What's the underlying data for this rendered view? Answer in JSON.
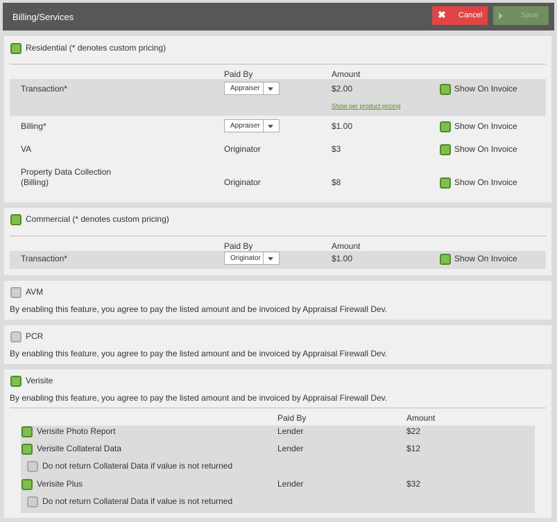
{
  "header": {
    "title": "Billing/Services",
    "cancel_label": "Cancel",
    "save_label": "Save"
  },
  "residential": {
    "title": "Residential (* denotes custom pricing)",
    "headers": {
      "paid_by": "Paid By",
      "amount": "Amount"
    },
    "rows": [
      {
        "name": "Transaction*",
        "paid_by": "Appraiser",
        "amount": "$2.00",
        "invoice": "Show On Invoice",
        "link": "Show per product pricing"
      },
      {
        "name": "Billing*",
        "paid_by": "Appraiser",
        "amount": "$1.00",
        "invoice": "Show On Invoice"
      },
      {
        "name": "VA",
        "paid_by": "Originator",
        "amount": "$3",
        "invoice": "Show On Invoice"
      },
      {
        "name_line1": "Property Data Collection",
        "name_line2": "(Billing)",
        "paid_by": "Originator",
        "amount": "$8",
        "invoice": "Show On Invoice"
      }
    ]
  },
  "commercial": {
    "title": "Commercial (* denotes custom pricing)",
    "headers": {
      "paid_by": "Paid By",
      "amount": "Amount"
    },
    "rows": [
      {
        "name": "Transaction*",
        "paid_by": "Originator",
        "amount": "$1.00",
        "invoice": "Show On Invoice"
      }
    ]
  },
  "avm": {
    "title": "AVM",
    "notice": "By enabling this feature, you agree to pay the listed amount and be invoiced by Appraisal Firewall Dev."
  },
  "pcr": {
    "title": "PCR",
    "notice": "By enabling this feature, you agree to pay the listed amount and be invoiced by Appraisal Firewall Dev."
  },
  "verisite": {
    "title": "Verisite",
    "notice": "By enabling this feature, you agree to pay the listed amount and be invoiced by Appraisal Firewall Dev.",
    "headers": {
      "paid_by": "Paid By",
      "amount": "Amount"
    },
    "rows": [
      {
        "name": "Verisite Photo Report",
        "paid_by": "Lender",
        "amount": "$22"
      },
      {
        "name": "Verisite Collateral Data",
        "paid_by": "Lender",
        "amount": "$12",
        "sub_option": "Do not return Collateral Data if value is not returned"
      },
      {
        "name": "Verisite Plus",
        "paid_by": "Lender",
        "amount": "$32",
        "sub_option": "Do not return Collateral Data if value is not returned"
      }
    ]
  },
  "colors": {
    "header_bg": "#575757",
    "cancel_bg": "#e04545",
    "save_bg": "#6f8f5e",
    "check_on": "#7fbf4b",
    "check_off": "#cfcfcf"
  }
}
